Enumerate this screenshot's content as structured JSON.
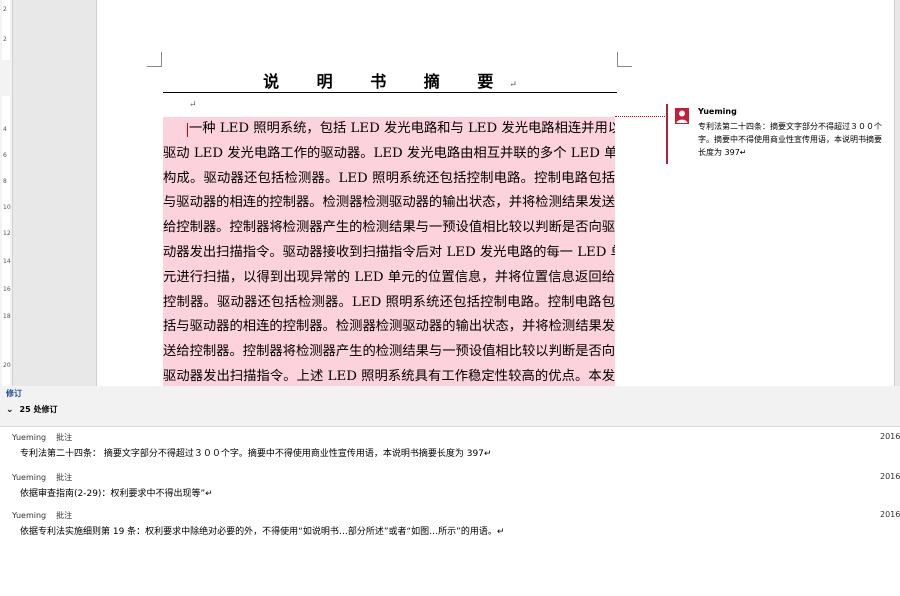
{
  "ruler": {
    "ticks": [
      "2",
      "2",
      "4",
      "6",
      "8",
      "10",
      "12",
      "14",
      "16",
      "18",
      "20"
    ]
  },
  "document": {
    "title": "说  明  书  摘  要",
    "pilcrow": "↵",
    "empty_para": "↵",
    "body_lines": [
      "一种 LED 照明系统，包括 LED 发光电路和与 LED 发光电路相连并用以",
      "驱动 LED 发光电路工作的驱动器。LED 发光电路由相互并联的多个 LED 单元",
      "构成。驱动器还包括检测器。LED 照明系统还包括控制电路。控制电路包括",
      "与驱动器的相连的控制器。检测器检测驱动器的输出状态，并将检测结果发送",
      "给控制器。控制器将检测器产生的检测结果与一预设值相比较以判断是否向驱",
      "动器发出扫描指令。驱动器接收到扫描指令后对 LED 发光电路的每一 LED 单",
      "元进行扫描，以得到出现异常的 LED 单元的位置信息，并将位置信息返回给",
      "控制器。驱动器还包括检测器。LED 照明系统还包括控制电路。控制电路包",
      "括与驱动器的相连的控制器。检测器检测驱动器的输出状态，并将检测结果发",
      "送给控制器。控制器将检测器产生的检测结果与一预设值相比较以判断是否向",
      "驱动器发出扫描指令。上述 LED 照明系统具有工作稳定性较高的优点。本发"
    ]
  },
  "balloon": {
    "author": "Yueming",
    "text": "专利法第二十四条：摘要文字部分不得超过３００个字。摘要中不得使用商业性宣传用语，本说明书摘要长度为 397↵"
  },
  "revisions": {
    "title": "修订",
    "count_label": "25 处修订",
    "entries": [
      {
        "author": "Yueming",
        "kind": "批注",
        "date": "2016",
        "text": "专利法第二十四条：  摘要文字部分不得超过３００个字。摘要中不得使用商业性宣传用语，本说明书摘要长度为 397↵"
      },
      {
        "author": "Yueming",
        "kind": "批注",
        "date": "2016",
        "text": "依据审查指南(2-29)：权利要求中不得出现等”↵"
      },
      {
        "author": "Yueming",
        "kind": "批注",
        "date": "2016",
        "text": "依据专利法实施细则第 19 条：权利要求中除绝对必要的外，不得使用“如说明书…部分所述”或者“如图…所示”的用语。↵"
      }
    ]
  },
  "colors": {
    "highlight": "#fcd3dc",
    "comment_red": "#c41e3a",
    "panel_title": "#1f4e9a"
  }
}
